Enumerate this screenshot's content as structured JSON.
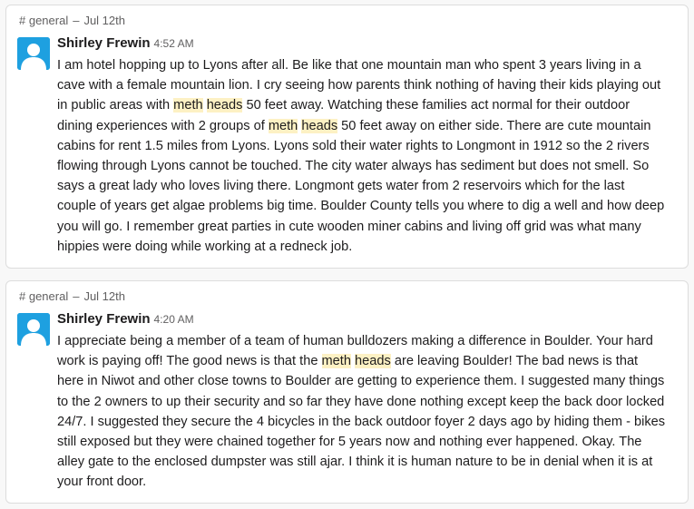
{
  "messages": [
    {
      "channel": "# general",
      "separator": "–",
      "date": "Jul 12th",
      "author": "Shirley Frewin",
      "time": "4:52 AM",
      "segments": [
        "I am hotel hopping up to Lyons after all. Be like that one mountain man who spent 3 years living in a cave with a female mountain lion. I cry seeing how parents think nothing of having their kids playing out in public areas with ",
        "meth",
        " ",
        "heads",
        " 50 feet away. Watching these families act normal for their outdoor dining experiences with 2 groups of ",
        "meth",
        " ",
        "heads",
        " 50 feet away on either side. There are cute mountain cabins for rent 1.5 miles from Lyons. Lyons sold their water rights to Longmont in 1912 so the 2 rivers flowing through Lyons cannot be touched. The city water always has sediment but does not smell. So says a great lady who loves living there. Longmont gets water from 2 reservoirs which for the last couple of years get algae problems big time. Boulder County tells you where to dig a well and how deep you will go. I remember great parties in cute wooden miner cabins and living off grid was what many hippies were doing while working at a redneck job."
      ]
    },
    {
      "channel": "# general",
      "separator": "–",
      "date": "Jul 12th",
      "author": "Shirley Frewin",
      "time": "4:20 AM",
      "segments": [
        "I appreciate being a member of a team of human bulldozers making a difference in Boulder. Your hard work is paying off! The good news is that the ",
        "meth",
        " ",
        "heads",
        " are leaving Boulder! The bad news is that here in Niwot and other close towns to Boulder are getting to experience them. I suggested many things to the 2 owners to up their security and so far they have done nothing except keep the back door locked 24/7. I suggested they secure the 4 bicycles in the back outdoor foyer 2 days ago by hiding them - bikes still exposed but they were chained together for 5 years now and nothing ever happened. Okay. The alley gate to  the enclosed dumpster was still ajar. I think it is human nature to be in denial when it is at your front door."
      ]
    }
  ],
  "colors": {
    "highlight": "#fdf1c4",
    "avatar": "#1ea0e0",
    "muted_text": "#616061"
  },
  "icons": {
    "avatar": "default-user-avatar-icon"
  }
}
